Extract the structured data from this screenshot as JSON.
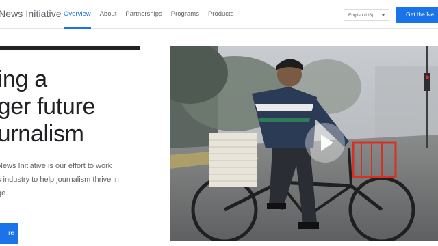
{
  "header": {
    "brand": "News Initiative",
    "nav": [
      {
        "label": "Overview",
        "active": true
      },
      {
        "label": "About",
        "active": false
      },
      {
        "label": "Partnerships",
        "active": false
      },
      {
        "label": "Programs",
        "active": false
      },
      {
        "label": "Products",
        "active": false
      }
    ],
    "language": "English (US)",
    "cta_label": "Get the Ne"
  },
  "hero": {
    "headline_lines": [
      "ding a",
      "nger future",
      "ournalism"
    ],
    "intro_lines": [
      "News Initiative is our effort to work",
      "s industry to help journalism thrive in",
      "ge."
    ],
    "button_label": "re"
  },
  "media": {
    "video": true,
    "play_icon": "play-icon"
  },
  "colors": {
    "accent": "#1a73e8",
    "text": "#202124",
    "muted": "#5f6368"
  }
}
